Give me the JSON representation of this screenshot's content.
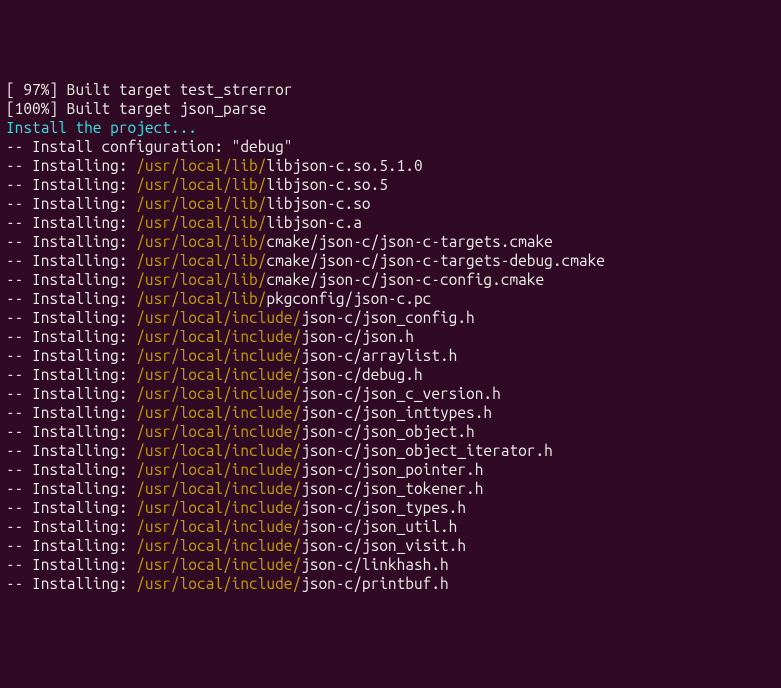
{
  "build": [
    {
      "pct": "[ 97%]",
      "text": " Built target test_strerror"
    },
    {
      "pct": "[100%]",
      "text": " Built target json_parse"
    }
  ],
  "install_header": "Install the project...",
  "config_line": "-- Install configuration: \"debug\"",
  "installs": [
    {
      "dir": "/usr/local/lib/",
      "file": "libjson-c.so.5.1.0"
    },
    {
      "dir": "/usr/local/lib/",
      "file": "libjson-c.so.5"
    },
    {
      "dir": "/usr/local/lib/",
      "file": "libjson-c.so"
    },
    {
      "dir": "/usr/local/lib/",
      "file": "libjson-c.a"
    },
    {
      "dir": "/usr/local/lib/",
      "file": "cmake/json-c/json-c-targets.cmake"
    },
    {
      "dir": "/usr/local/lib/",
      "file": "cmake/json-c/json-c-targets-debug.cmake"
    },
    {
      "dir": "/usr/local/lib/",
      "file": "cmake/json-c/json-c-config.cmake"
    },
    {
      "dir": "/usr/local/lib/",
      "file": "pkgconfig/json-c.pc"
    },
    {
      "dir": "/usr/local/include/",
      "file": "json-c/json_config.h"
    },
    {
      "dir": "/usr/local/include/",
      "file": "json-c/json.h"
    },
    {
      "dir": "/usr/local/include/",
      "file": "json-c/arraylist.h"
    },
    {
      "dir": "/usr/local/include/",
      "file": "json-c/debug.h"
    },
    {
      "dir": "/usr/local/include/",
      "file": "json-c/json_c_version.h"
    },
    {
      "dir": "/usr/local/include/",
      "file": "json-c/json_inttypes.h"
    },
    {
      "dir": "/usr/local/include/",
      "file": "json-c/json_object.h"
    },
    {
      "dir": "/usr/local/include/",
      "file": "json-c/json_object_iterator.h"
    },
    {
      "dir": "/usr/local/include/",
      "file": "json-c/json_pointer.h"
    },
    {
      "dir": "/usr/local/include/",
      "file": "json-c/json_tokener.h"
    },
    {
      "dir": "/usr/local/include/",
      "file": "json-c/json_types.h"
    },
    {
      "dir": "/usr/local/include/",
      "file": "json-c/json_util.h"
    },
    {
      "dir": "/usr/local/include/",
      "file": "json-c/json_visit.h"
    },
    {
      "dir": "/usr/local/include/",
      "file": "json-c/linkhash.h"
    },
    {
      "dir": "/usr/local/include/",
      "file": "json-c/printbuf.h"
    }
  ],
  "install_prefix": "-- Installing: "
}
